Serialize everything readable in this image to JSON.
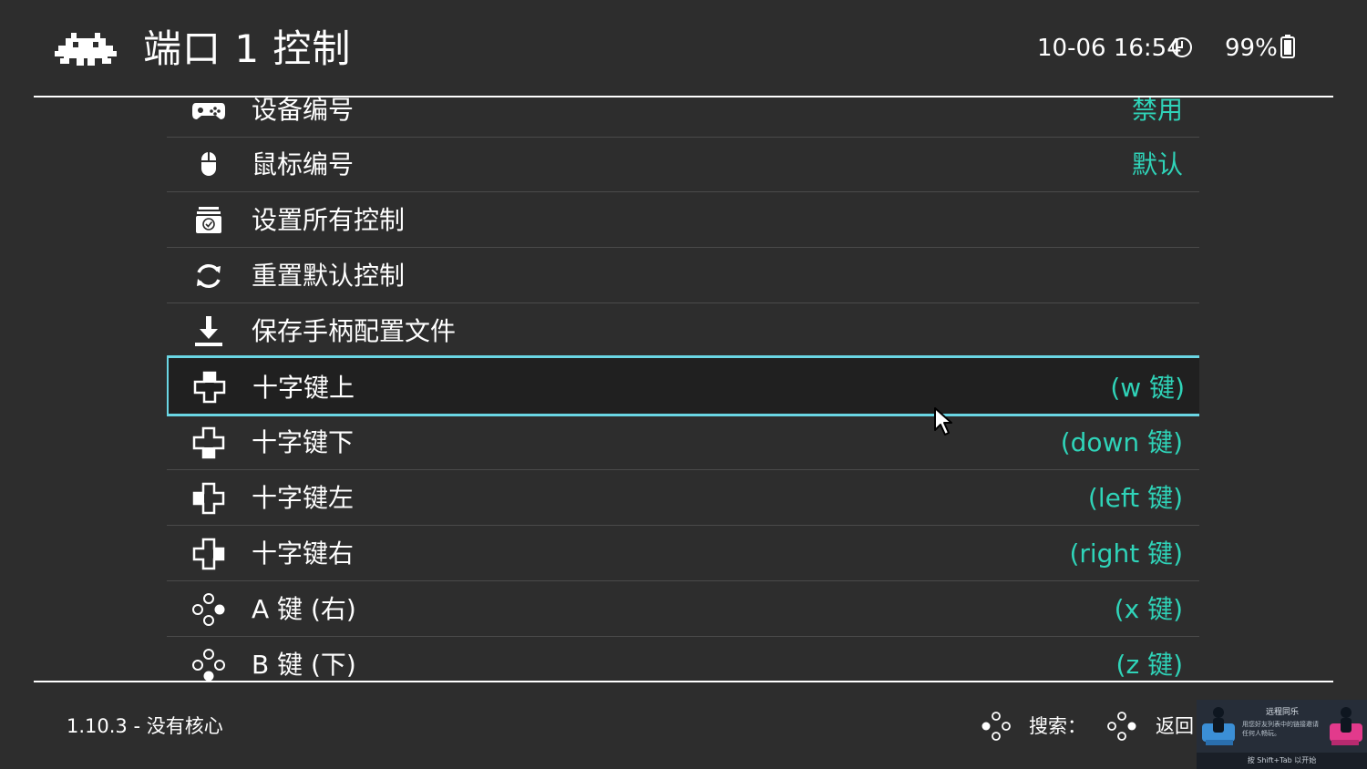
{
  "header": {
    "title": "端口 1 控制",
    "datetime": "10-06 16:54",
    "battery": "99%"
  },
  "menu": {
    "items": [
      {
        "icon": "gamepad-icon",
        "label": "设备编号",
        "value": "禁用"
      },
      {
        "icon": "mouse-icon",
        "label": "鼠标编号",
        "value": "默认"
      },
      {
        "icon": "settings-all-icon",
        "label": "设置所有控制",
        "value": ""
      },
      {
        "icon": "reset-icon",
        "label": "重置默认控制",
        "value": ""
      },
      {
        "icon": "download-icon",
        "label": "保存手柄配置文件",
        "value": ""
      },
      {
        "icon": "dpad-up-icon",
        "label": "十字键上",
        "value": "(w 键)",
        "selected": true
      },
      {
        "icon": "dpad-down-icon",
        "label": "十字键下",
        "value": "(down 键)"
      },
      {
        "icon": "dpad-left-icon",
        "label": "十字键左",
        "value": "(left 键)"
      },
      {
        "icon": "dpad-right-icon",
        "label": "十字键右",
        "value": "(right 键)"
      },
      {
        "icon": "face-button-right-icon",
        "label": "A 键 (右)",
        "value": "(x 键)"
      },
      {
        "icon": "face-button-down-icon",
        "label": "B 键 (下)",
        "value": "(z 键)"
      }
    ]
  },
  "footer": {
    "version": "1.10.3 - 没有核心",
    "search_label": "搜索：",
    "back_label": "返回"
  },
  "notification": {
    "title": "远程同乐",
    "text": "用您好友列表中的链接邀请任何人畅玩。",
    "hint": "按 Shift+Tab 以开始"
  },
  "colors": {
    "background": "#2d2d2d",
    "accent_value": "#2fd3b8",
    "selection_border": "#6ad6e4"
  }
}
